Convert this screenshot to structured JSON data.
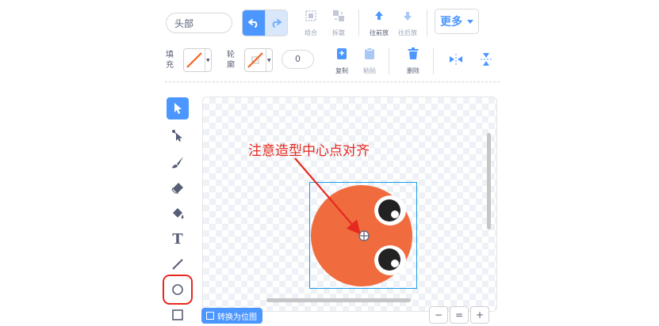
{
  "costume": {
    "name_value": "头部"
  },
  "toolbar_top": {
    "group_label": "组合",
    "ungroup_label": "拆散",
    "forward_label": "往前放",
    "backward_label": "往后放",
    "more_label": "更多"
  },
  "toolbar_second": {
    "fill_label_1": "填",
    "fill_label_2": "充",
    "outline_label_1": "轮",
    "outline_label_2": "廓",
    "outline_width": "0",
    "copy_label": "复制",
    "paste_label": "粘贴",
    "delete_label": "删除"
  },
  "tools": [
    "select",
    "reshape",
    "brush",
    "eraser",
    "fill",
    "text",
    "line",
    "circle",
    "rectangle"
  ],
  "active_tool": "select",
  "highlighted_tool": "circle",
  "canvas": {
    "annotation_text": "注意造型中心点对齐",
    "convert_button_label": "转换为位图"
  },
  "colors": {
    "accent": "#4c97ff",
    "annotation": "#e5291f",
    "fill_swatch_line": "#f26522",
    "head_fill": "#f06c3f",
    "selection": "#1c9ce6"
  }
}
